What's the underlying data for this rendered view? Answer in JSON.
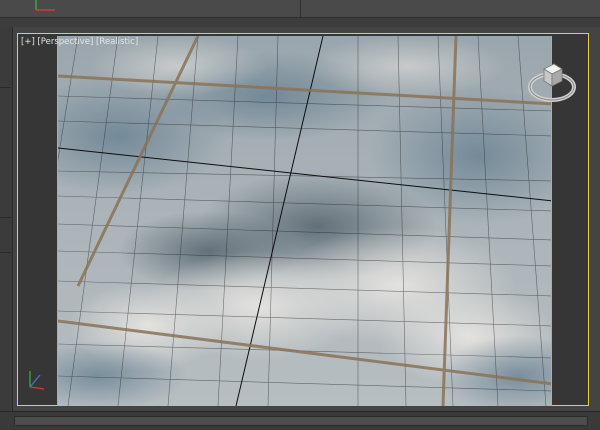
{
  "viewport": {
    "plus_label": "[+]",
    "view_label": "[Perspective]",
    "shading_label": "[Realistic]",
    "active_border_color": "#e6cf45",
    "safe_frame_color": "#c9b43c"
  },
  "scene": {
    "material": "tile-floor",
    "tile_color": "#b9c2c7",
    "shadow_color": "#6f7f88",
    "grout_color": "#8a7358",
    "grid_line_color": "#111111"
  },
  "icons": {
    "viewcube": "viewcube-icon",
    "axis_tripod": "axis-tripod-icon",
    "top_axis": "axis-icon"
  }
}
